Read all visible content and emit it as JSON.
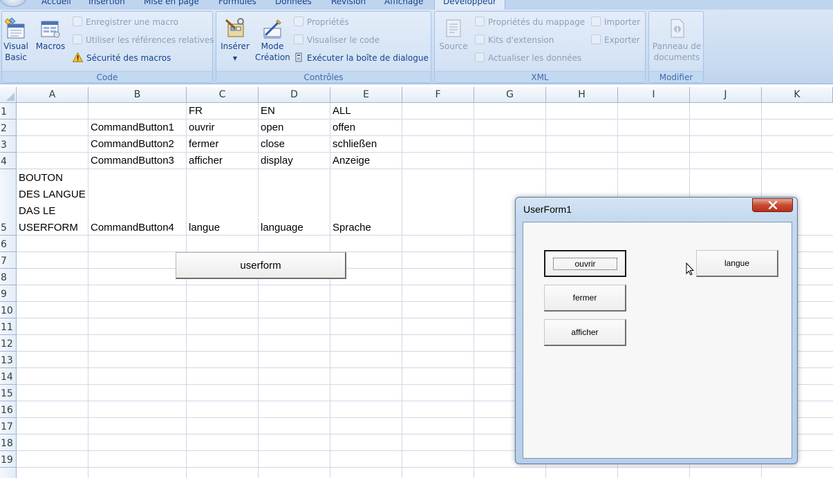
{
  "ribbon": {
    "tabs": [
      "Accueil",
      "Insertion",
      "Mise en page",
      "Formules",
      "Données",
      "Révision",
      "Affichage",
      "Développeur"
    ],
    "code": {
      "label": "Code",
      "visual_basic": "Visual Basic",
      "visual_basic_l1": "Visual",
      "visual_basic_l2": "Basic",
      "macros": "Macros",
      "record_macro": "Enregistrer une macro",
      "relative_refs": "Utiliser les références relatives",
      "macro_security": "Sécurité des macros"
    },
    "controls": {
      "label": "Contrôles",
      "insert": "Insérer",
      "design_mode_l1": "Mode",
      "design_mode_l2": "Création",
      "properties": "Propriétés",
      "view_code": "Visualiser le code",
      "run_dialog": "Exécuter la boîte de dialogue"
    },
    "xml": {
      "label": "XML",
      "source": "Source",
      "map_properties": "Propriétés du mappage",
      "expansion_packs": "Kits d'extension",
      "refresh_data": "Actualiser les données",
      "import": "Importer",
      "export": "Exporter"
    },
    "modify": {
      "label": "Modifier",
      "doc_panel_l1": "Panneau de",
      "doc_panel_l2": "documents"
    }
  },
  "sheet": {
    "columns": [
      "A",
      "B",
      "C",
      "D",
      "E",
      "F",
      "G",
      "H",
      "I",
      "J",
      "K"
    ],
    "rows": [
      "1",
      "2",
      "3",
      "4",
      "5",
      "6",
      "7",
      "8",
      "9",
      "10",
      "11",
      "12",
      "13",
      "14",
      "15",
      "16",
      "17",
      "18",
      "19"
    ],
    "cells": {
      "C1": "FR",
      "D1": "EN",
      "E1": "ALL",
      "B2": "CommandButton1",
      "C2": "ouvrir",
      "D2": "open",
      "E2": "offen",
      "B3": "CommandButton2",
      "C3": "fermer",
      "D3": "close",
      "E3": "schließen",
      "B4": "CommandButton3",
      "C4": "afficher",
      "D4": "display",
      "E4": "Anzeige",
      "A5_l1": "BOUTON",
      "A5_l2": "DES LANGUE",
      "A5_l3": "DAS LE",
      "A5_l4": "USERFORM",
      "B5": "CommandButton4",
      "C5": "langue",
      "D5": "language",
      "E5": "Sprache"
    },
    "button_label": "userform"
  },
  "userform": {
    "title": "UserForm1",
    "buttons": [
      "ouvrir",
      "fermer",
      "afficher",
      "langue"
    ]
  },
  "colors": {
    "ribbon_text": "#15428b",
    "close_button": "#c84a31",
    "grid_line": "#d0d7e5"
  }
}
